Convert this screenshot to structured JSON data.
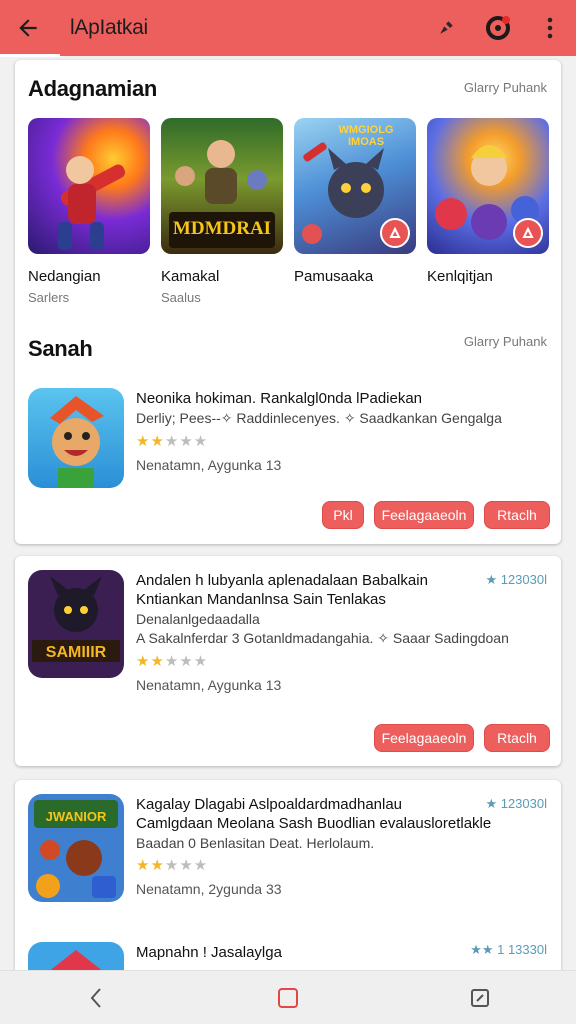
{
  "appbar": {
    "title": "lApIatkai",
    "back_icon": "arrow-back-icon",
    "actions": [
      "pin-icon",
      "profile-icon",
      "more-vert-icon"
    ]
  },
  "section_featured": {
    "title": "Adagnamian",
    "link": "Glarry Puhank",
    "items": [
      {
        "name": "Nedangian",
        "sub": "Sarlers",
        "art_caption": ""
      },
      {
        "name": "Kamakal",
        "sub": "Saalus",
        "art_caption": "MDMDRAI"
      },
      {
        "name": "Pamusaaka",
        "sub": "",
        "art_caption": "WMGIOLG IMOAS"
      },
      {
        "name": "Kenlqitjan",
        "sub": "",
        "art_caption": ""
      }
    ]
  },
  "section_list": {
    "title": "Sanah",
    "link": "Glarry Puhank"
  },
  "apps": [
    {
      "line1": "Neonika hokiman. Rankalgl0nda lPadiekan",
      "line2": "Derliy; Pees--✧ Raddinlecenyes. ✧ Saadkankan Gengalga",
      "line3": "",
      "line4": "",
      "rating": 2,
      "meta": "Nenatamn, Aygunka 13",
      "buttons": [
        "Pkl",
        "Feelagaaeoln",
        "Rtaclh"
      ],
      "rank": ""
    },
    {
      "line1": "Andalen h lubyanla aplenadalaan Babalkain",
      "line2": "Kntiankan Mandanlnsa Sain Tenlakas",
      "line3": "Denalanlgedaadalla",
      "line4": "A Sakalnferdar 3 Gotanldmadangahia. ✧ Saaar Sadingdoan",
      "rating": 2,
      "meta": "Nenatamn, Aygunka 13",
      "buttons": [
        "Feelagaaeoln",
        "Rtaclh"
      ],
      "rank": "★ 123030l"
    },
    {
      "line1": "Kagalay Dlagabi Aslpoaldardmadhanlau",
      "line2": "Camlgdaan Meolana Sash Buodlian evalausloretlakle",
      "line3": "Baadan 0 Benlasitan Deat. Herlolaum.",
      "line4": "",
      "rating": 2,
      "meta": "Nenatamn, 2ygunda 33",
      "buttons": [],
      "rank": "★ 123030l"
    },
    {
      "line1": "Mapnahn ! Jasalaylga",
      "rank": "★★ 1 13330l"
    }
  ],
  "colors": {
    "accent": "#ec5f5d",
    "star": "#f2b824",
    "star_off": "#bdbdbd"
  },
  "navbar": [
    "back-nav-icon",
    "home-nav-icon",
    "recents-nav-icon"
  ]
}
